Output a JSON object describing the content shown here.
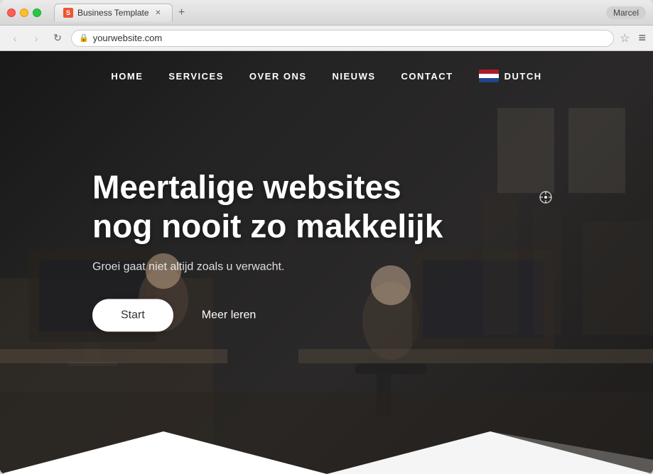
{
  "browser": {
    "tab_favicon": "S",
    "tab_title": "Business Template",
    "url": "yourwebsite.com",
    "user": "Marcel"
  },
  "nav": {
    "links": [
      {
        "id": "home",
        "label": "HOME"
      },
      {
        "id": "services",
        "label": "SERVICES"
      },
      {
        "id": "over-ons",
        "label": "OVER ONS"
      },
      {
        "id": "nieuws",
        "label": "NIEUWS"
      },
      {
        "id": "contact",
        "label": "CONTACT"
      }
    ],
    "lang_label": "DUTCH"
  },
  "hero": {
    "title_line1": "Meertalige websites",
    "title_line2": "nog nooit zo makkelijk",
    "subtitle": "Groei gaat niet altijd zoals u verwacht.",
    "btn_start": "Start",
    "btn_meer": "Meer leren"
  }
}
